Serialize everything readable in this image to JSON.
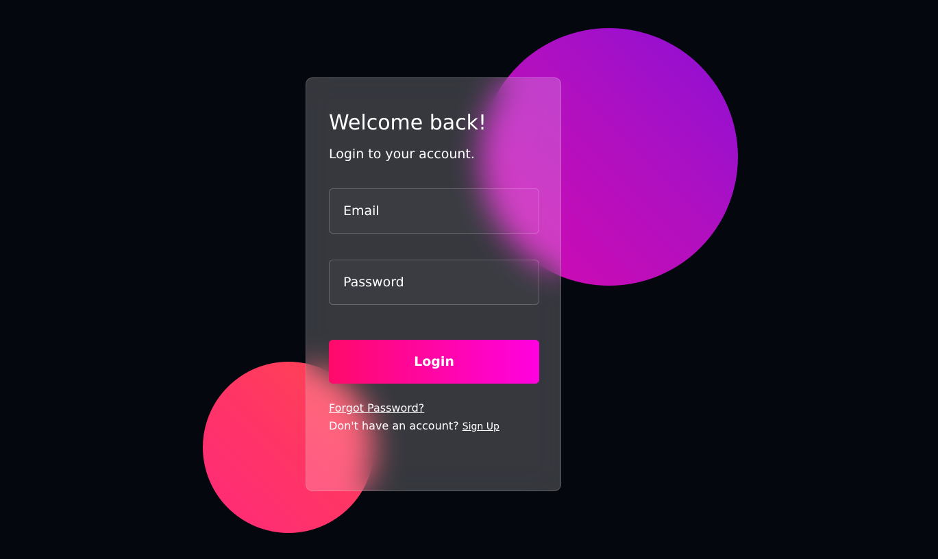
{
  "colors": {
    "background": "#04070e",
    "accent_gradient_start": "#ff0a6a",
    "accent_gradient_end": "#ff02e0",
    "purple_circle": "#b010c0",
    "red_circle": "#ff3565"
  },
  "login_card": {
    "title": "Welcome back!",
    "subtitle": "Login to your account.",
    "email_placeholder": "Email",
    "password_placeholder": "Password",
    "login_label": "Login",
    "forgot_password": "Forgot Password?",
    "no_account_text": "Don't have an account?",
    "signup_label": "Sign Up"
  }
}
